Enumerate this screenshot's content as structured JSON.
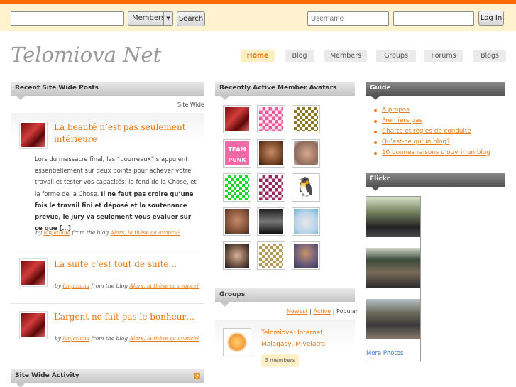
{
  "topbar": {
    "search_value": "",
    "search_scope": "Members",
    "search_button": "Search",
    "username_placeholder": "Username",
    "password_value": "",
    "login_button": "Log In"
  },
  "site": {
    "title": "Telomiova Net"
  },
  "nav": [
    "Home",
    "Blog",
    "Members",
    "Groups",
    "Forums",
    "Blogs"
  ],
  "posts_widget": {
    "title": "Recent Site Wide Posts",
    "filter": "Site Wide",
    "posts": [
      {
        "title": "La beauté n’est pas seulement intérieure",
        "excerpt_plain": "Lors du massacre final, les “bourreaux” s’appuient essentiellement sur deux points pour achever votre travail et tester vos capacités: le fond de la Chose, et la forme de la Chose.",
        "excerpt_bold": "Il ne faut pas croire qu’une fois le travail fini et déposé et la soutenance prévue, le jury va seulement vous évaluer sur ce que […]",
        "by": "by",
        "author": "lanjatiana",
        "from": "from the blog",
        "blog": "Alors, la thèse ça avance?"
      },
      {
        "title": "La suite c’est tout de suite…",
        "by": "by",
        "author": "lanjatiana",
        "from": "from the blog",
        "blog": "Alors, la thèse ça avance?"
      },
      {
        "title": "L’argent ne fait pas le bonheur…",
        "by": "by",
        "author": "lanjatiana",
        "from": "from the blog",
        "blog": "Alors, la thèse ça avance?"
      }
    ]
  },
  "activity_widget": {
    "title": "Site Wide Activity",
    "icon": "rss-icon"
  },
  "avatars_widget": {
    "title": "Recently Active Member Avatars"
  },
  "groups_widget": {
    "title": "Groups",
    "filters": [
      "Newest",
      "Active",
      "Popular"
    ],
    "sep": "|",
    "group_name": "Telomiova: Internet, Malagasy, Mivelatra",
    "members": "3 members"
  },
  "guide_widget": {
    "title": "Guide",
    "links": [
      "A propos",
      "Premiers pas",
      "Charte et règles de conduite",
      "Qu'est-ce qu'un blog?",
      "10 bonnes raisons d'ouvrir un blog"
    ]
  },
  "flickr_widget": {
    "title": "Flickr",
    "more": "More Photos"
  },
  "colors": {
    "accent": "#ee6f00",
    "stripe": "#ff6a00",
    "topbar_bg": "#fff3cf"
  }
}
